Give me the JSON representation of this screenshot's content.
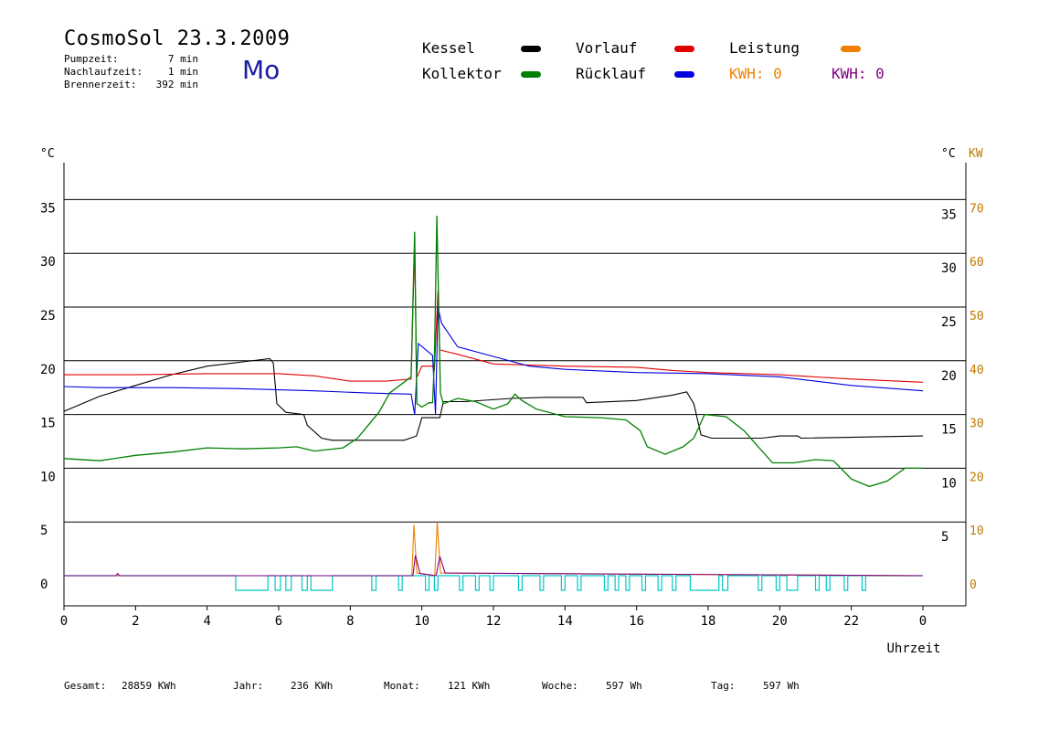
{
  "header": {
    "title": "CosmoSol 23.3.2009",
    "day": "Mo",
    "pump_label": "Pumpzeit:",
    "pump_value": "7 min",
    "nachlauf_label": "Nachlaufzeit:",
    "nachlauf_value": "1 min",
    "brenner_label": "Brennerzeit:",
    "brenner_value": "392 min"
  },
  "legend": {
    "kessel": "Kessel",
    "kollektor": "Kollektor",
    "vorlauf": "Vorlauf",
    "ruecklauf": "Rücklauf",
    "leistung": "Leistung",
    "kwh1": "KWH: 0",
    "kwh2": "KWH: 0"
  },
  "colors": {
    "kessel": "#000000",
    "kollektor": "#008000",
    "vorlauf": "#e00000",
    "ruecklauf": "#0000e0",
    "leistung": "#f08000",
    "kwh2": "#800080",
    "pump": "#00c8c8"
  },
  "footer": {
    "gesamt_label": "Gesamt:",
    "gesamt_value": "28859 KWh",
    "jahr_label": "Jahr:",
    "jahr_value": "236 KWh",
    "monat_label": "Monat:",
    "monat_value": "121 KWh",
    "woche_label": "Woche:",
    "woche_value": "597 Wh",
    "tag_label": "Tag:",
    "tag_value": "597 Wh"
  },
  "chart_data": {
    "type": "line",
    "title": "CosmoSol 23.3.2009",
    "xlabel": "Uhrzeit",
    "ylabel_left": "°C",
    "ylabel_right_temp": "°C",
    "ylabel_right_power": "KW",
    "xlim": [
      0,
      24
    ],
    "ylim": [
      0,
      40
    ],
    "x_ticks": [
      "0",
      "2",
      "4",
      "6",
      "8",
      "10",
      "12",
      "14",
      "16",
      "18",
      "20",
      "22",
      "0"
    ],
    "y_ticks": [
      0,
      5,
      10,
      15,
      20,
      25,
      30,
      35
    ],
    "kw_ticks": [
      0,
      10,
      20,
      30,
      40,
      50,
      60,
      70
    ],
    "series": [
      {
        "name": "Kessel",
        "color": "#000000",
        "points": [
          [
            0,
            15.3
          ],
          [
            1,
            16.7
          ],
          [
            2,
            17.7
          ],
          [
            3,
            18.7
          ],
          [
            4,
            19.5
          ],
          [
            5,
            19.9
          ],
          [
            5.75,
            20.2
          ],
          [
            5.85,
            19.8
          ],
          [
            5.95,
            16.0
          ],
          [
            6.2,
            15.2
          ],
          [
            6.7,
            15.0
          ],
          [
            6.8,
            14.0
          ],
          [
            7.2,
            12.8
          ],
          [
            7.5,
            12.6
          ],
          [
            9.5,
            12.6
          ],
          [
            9.85,
            13.0
          ],
          [
            10.0,
            14.7
          ],
          [
            10.5,
            14.7
          ],
          [
            10.6,
            16.2
          ],
          [
            11.2,
            16.2
          ],
          [
            12.5,
            16.5
          ],
          [
            13.5,
            16.6
          ],
          [
            14.5,
            16.6
          ],
          [
            14.6,
            16.1
          ],
          [
            16,
            16.3
          ],
          [
            17,
            16.8
          ],
          [
            17.4,
            17.1
          ],
          [
            17.6,
            16.0
          ],
          [
            17.8,
            13.1
          ],
          [
            18.1,
            12.8
          ],
          [
            19.5,
            12.8
          ],
          [
            20,
            13.0
          ],
          [
            20.5,
            13.0
          ],
          [
            20.6,
            12.8
          ],
          [
            24,
            13.0
          ]
        ]
      },
      {
        "name": "Vorlauf",
        "color": "#e00000",
        "points": [
          [
            0,
            18.7
          ],
          [
            2,
            18.7
          ],
          [
            4,
            18.8
          ],
          [
            6,
            18.8
          ],
          [
            7,
            18.6
          ],
          [
            8,
            18.1
          ],
          [
            9,
            18.1
          ],
          [
            9.7,
            18.3
          ],
          [
            9.8,
            31.0
          ],
          [
            9.85,
            18.4
          ],
          [
            10,
            19.5
          ],
          [
            10.3,
            19.5
          ],
          [
            10.35,
            19.2
          ],
          [
            10.45,
            26.5
          ],
          [
            10.5,
            21.0
          ],
          [
            11,
            20.6
          ],
          [
            12,
            19.7
          ],
          [
            14,
            19.5
          ],
          [
            16,
            19.4
          ],
          [
            17,
            19.1
          ],
          [
            18,
            18.9
          ],
          [
            20,
            18.7
          ],
          [
            22,
            18.3
          ],
          [
            24,
            18.0
          ]
        ]
      },
      {
        "name": "Rücklauf",
        "color": "#0000e0",
        "points": [
          [
            0,
            17.6
          ],
          [
            1,
            17.5
          ],
          [
            3,
            17.5
          ],
          [
            5,
            17.4
          ],
          [
            7,
            17.2
          ],
          [
            8.5,
            17.0
          ],
          [
            9.7,
            16.9
          ],
          [
            9.8,
            15.0
          ],
          [
            9.9,
            21.6
          ],
          [
            10.3,
            20.5
          ],
          [
            10.38,
            15.0
          ],
          [
            10.45,
            25.0
          ],
          [
            10.55,
            23.5
          ],
          [
            11,
            21.3
          ],
          [
            12,
            20.4
          ],
          [
            13,
            19.5
          ],
          [
            14,
            19.2
          ],
          [
            16,
            18.9
          ],
          [
            18,
            18.8
          ],
          [
            20,
            18.5
          ],
          [
            22,
            17.7
          ],
          [
            24,
            17.2
          ]
        ]
      },
      {
        "name": "Kollektor",
        "color": "#008000",
        "points": [
          [
            0,
            10.9
          ],
          [
            1,
            10.7
          ],
          [
            2,
            11.2
          ],
          [
            3,
            11.5
          ],
          [
            4,
            11.9
          ],
          [
            5,
            11.8
          ],
          [
            6,
            11.9
          ],
          [
            6.5,
            12.0
          ],
          [
            7,
            11.6
          ],
          [
            7.8,
            11.9
          ],
          [
            8.2,
            12.8
          ],
          [
            8.8,
            15.2
          ],
          [
            9.1,
            17.0
          ],
          [
            9.5,
            18.0
          ],
          [
            9.7,
            18.5
          ],
          [
            9.8,
            32.0
          ],
          [
            9.86,
            16.0
          ],
          [
            10,
            15.7
          ],
          [
            10.2,
            16.1
          ],
          [
            10.3,
            16.1
          ],
          [
            10.35,
            20.0
          ],
          [
            10.42,
            33.5
          ],
          [
            10.52,
            17.0
          ],
          [
            10.6,
            16.0
          ],
          [
            11,
            16.5
          ],
          [
            11.5,
            16.2
          ],
          [
            12,
            15.5
          ],
          [
            12.4,
            16.0
          ],
          [
            12.6,
            16.9
          ],
          [
            12.8,
            16.3
          ],
          [
            13.2,
            15.5
          ],
          [
            14,
            14.8
          ],
          [
            15,
            14.7
          ],
          [
            15.7,
            14.5
          ],
          [
            16.1,
            13.5
          ],
          [
            16.3,
            12.0
          ],
          [
            16.8,
            11.3
          ],
          [
            17.3,
            12.0
          ],
          [
            17.6,
            12.8
          ],
          [
            17.9,
            15.0
          ],
          [
            18.5,
            14.8
          ],
          [
            19,
            13.5
          ],
          [
            19.4,
            12.0
          ],
          [
            19.8,
            10.5
          ],
          [
            20.4,
            10.5
          ],
          [
            21,
            10.8
          ],
          [
            21.5,
            10.7
          ],
          [
            22,
            9.0
          ],
          [
            22.5,
            8.3
          ],
          [
            23,
            8.8
          ],
          [
            23.5,
            10.0
          ],
          [
            24,
            10.0
          ]
        ]
      },
      {
        "name": "Leistung",
        "color": "#f08000",
        "unit": "KW",
        "points": [
          [
            0,
            0
          ],
          [
            9.72,
            0
          ],
          [
            9.78,
            9.5
          ],
          [
            9.86,
            0.5
          ],
          [
            10.36,
            0
          ],
          [
            10.43,
            10.0
          ],
          [
            10.52,
            0.5
          ],
          [
            24,
            0
          ]
        ]
      },
      {
        "name": "KWH",
        "color": "#800080",
        "unit": "KW",
        "points": [
          [
            0,
            0
          ],
          [
            1.45,
            0
          ],
          [
            1.5,
            0.4
          ],
          [
            1.55,
            0
          ],
          [
            9.75,
            0
          ],
          [
            9.82,
            3.8
          ],
          [
            9.95,
            0.4
          ],
          [
            10.4,
            0
          ],
          [
            10.5,
            3.6
          ],
          [
            10.65,
            0.5
          ],
          [
            24,
            0
          ]
        ]
      }
    ],
    "pump_on_intervals": [
      [
        4.8,
        5.7
      ],
      [
        5.9,
        6.05
      ],
      [
        6.2,
        6.35
      ],
      [
        6.65,
        6.8
      ],
      [
        6.9,
        7.5
      ],
      [
        8.6,
        8.72
      ],
      [
        9.35,
        9.45
      ],
      [
        10.1,
        10.2
      ],
      [
        10.35,
        10.45
      ],
      [
        11.05,
        11.15
      ],
      [
        11.5,
        11.6
      ],
      [
        11.9,
        12.0
      ],
      [
        12.7,
        12.8
      ],
      [
        13.3,
        13.4
      ],
      [
        13.9,
        14.0
      ],
      [
        14.35,
        14.45
      ],
      [
        15.1,
        15.2
      ],
      [
        15.4,
        15.5
      ],
      [
        15.7,
        15.8
      ],
      [
        16.15,
        16.25
      ],
      [
        16.6,
        16.7
      ],
      [
        17.0,
        17.1
      ],
      [
        17.5,
        18.3
      ],
      [
        18.4,
        18.55
      ],
      [
        19.4,
        19.5
      ],
      [
        19.9,
        20.0
      ],
      [
        20.2,
        20.5
      ],
      [
        21.0,
        21.1
      ],
      [
        21.3,
        21.4
      ],
      [
        21.8,
        21.9
      ],
      [
        22.3,
        22.4
      ]
    ]
  }
}
